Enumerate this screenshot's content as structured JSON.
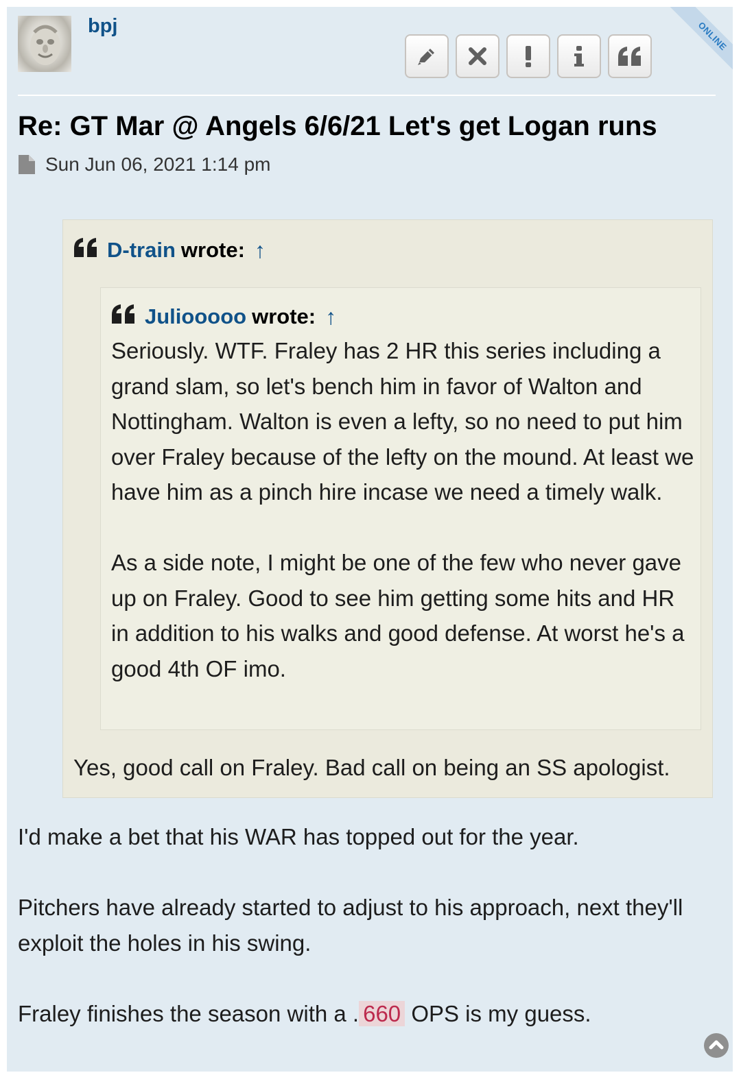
{
  "author": {
    "username": "bpj",
    "status": "ONLINE"
  },
  "tools": [
    {
      "name": "edit-button",
      "icon": "pencil-icon"
    },
    {
      "name": "delete-button",
      "icon": "close-icon"
    },
    {
      "name": "report-button",
      "icon": "exclamation-icon"
    },
    {
      "name": "info-button",
      "icon": "info-icon"
    },
    {
      "name": "quote-button",
      "icon": "quote-icon"
    }
  ],
  "post": {
    "title": "Re: GT Mar @ Angels 6/6/21 Let's get Logan runs",
    "date": "Sun Jun 06, 2021 1:14 pm"
  },
  "quote_outer": {
    "author": "D-train",
    "wrote": "wrote:",
    "arrow": "↑",
    "reply": "Yes, good call on Fraley. Bad call on being an SS apologist."
  },
  "quote_inner": {
    "author": "Juliooooo",
    "wrote": "wrote:",
    "arrow": "↑",
    "paragraphs": [
      "Seriously. WTF. Fraley has 2 HR this series including a grand slam, so let's bench him in favor of Walton and Nottingham. Walton is even a lefty, so no need to put him over Fraley because of the lefty on the mound. At least we have him as a pinch hire incase we need a timely walk.",
      "As a side note, I might be one of the few who never gave up on Fraley. Good to see him getting some hits and HR in addition to his walks and good defense. At worst he's a good 4th OF imo."
    ]
  },
  "body": {
    "p1": "I'd make a bet that his WAR has topped out for the year.",
    "p2": "Pitchers have already started to adjust to his approach, next they'll exploit the holes in his swing.",
    "p3_before": "Fraley finishes the season with a .",
    "p3_highlight": "660",
    "p3_after": " OPS is my guess."
  },
  "colors": {
    "post_bg": "#e1ebf2",
    "link": "#105289",
    "quote_bg": "#ebeadd",
    "highlight_bg": "#ecd5d8",
    "highlight_text": "#bc2a4d"
  }
}
